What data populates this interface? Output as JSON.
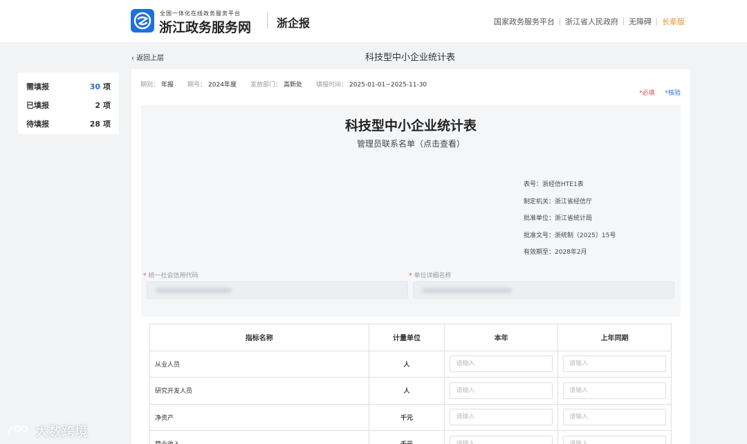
{
  "header": {
    "logo_sub": "全国一体化在线政务服务平台",
    "logo_main": "浙江政务服务网",
    "system_name": "浙企报",
    "links": [
      "国家政务服务平台",
      "浙江省人民政府",
      "无障碍"
    ],
    "elder_mode": "长辈版",
    "accent_color": "#1e6fd9",
    "elder_color": "#e8912d"
  },
  "nav": {
    "back_label": "返回上层",
    "page_title": "科技型中小企业统计表"
  },
  "stats": [
    {
      "label": "需填报",
      "value": "30",
      "unit": "项"
    },
    {
      "label": "已填报",
      "value": "2",
      "unit": "项"
    },
    {
      "label": "待填报",
      "value": "28",
      "unit": "项"
    }
  ],
  "meta": [
    {
      "label": "期别：",
      "value": "年报"
    },
    {
      "label": "期号：",
      "value": "2024年度"
    },
    {
      "label": "发放部门：",
      "value": "高新处"
    },
    {
      "label": "填报时间：",
      "value": "2025-01-01~2025-11-30"
    }
  ],
  "legend": {
    "required": "*必填",
    "verify": "*核验"
  },
  "form": {
    "title": "科技型中小企业统计表",
    "subtitle": "管理员联系名单（点击查看）",
    "info": [
      "表号：浙经信HTE1表",
      "制定机关：浙江省经信厅",
      "批准单位：浙江省统计局",
      "批准文号：浙统制〔2025〕15号",
      "有效期至：2028年2月"
    ],
    "fields": [
      {
        "label": "统一社会信用代码"
      },
      {
        "label": "单位详细名称"
      }
    ]
  },
  "table": {
    "headers": [
      "指标名称",
      "计量单位",
      "本年",
      "上年同期"
    ],
    "placeholder": "请输入",
    "rows": [
      {
        "name": "从业人员",
        "unit": "人"
      },
      {
        "name": "研究开发人员",
        "unit": "人"
      },
      {
        "name": "净资产",
        "unit": "千元"
      },
      {
        "name": "营业收入",
        "unit": "千元"
      }
    ]
  },
  "watermark": "大数跨境"
}
